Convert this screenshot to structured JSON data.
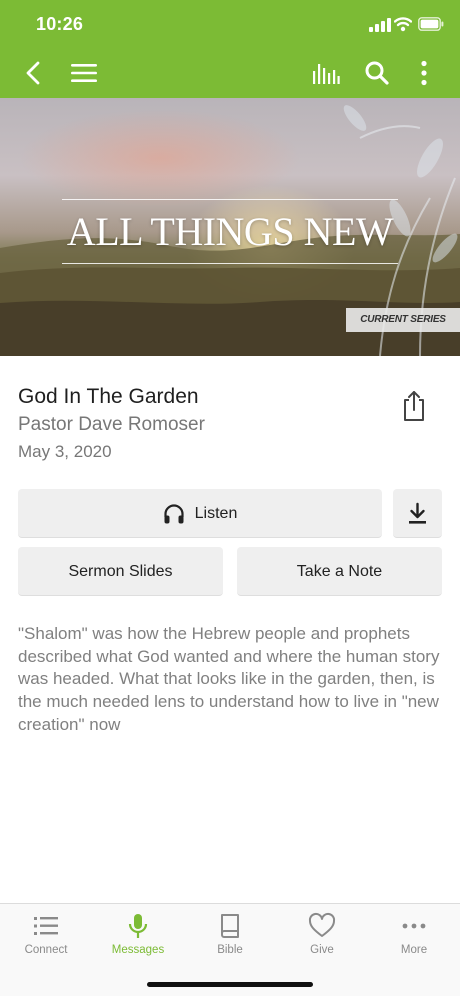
{
  "status_bar": {
    "time": "10:26"
  },
  "nav": {
    "back_icon": "chevron-left-icon",
    "menu_icon": "hamburger-menu-icon",
    "audio_icon": "audio-bars-icon",
    "search_icon": "search-icon",
    "more_icon": "vertical-dots-icon"
  },
  "hero": {
    "title": "ALL THINGS NEW",
    "tag": "CURRENT SERIES"
  },
  "sermon": {
    "title": "God In The Garden",
    "speaker": "Pastor Dave Romoser",
    "date": "May 3, 2020",
    "share_icon": "share-icon"
  },
  "actions": {
    "listen_label": "Listen",
    "listen_icon": "headphones-icon",
    "download_icon": "download-icon",
    "slides_label": "Sermon Slides",
    "note_label": "Take a Note"
  },
  "description": "\"Shalom\" was how the Hebrew people and prophets described what God wanted and where the human story was headed.  What that looks like in the garden, then, is the much needed lens to understand how to live in \"new creation\" now",
  "tabbar": {
    "items": [
      {
        "label": "Connect",
        "icon": "list-icon",
        "active": false
      },
      {
        "label": "Messages",
        "icon": "microphone-icon",
        "active": true
      },
      {
        "label": "Bible",
        "icon": "book-icon",
        "active": false
      },
      {
        "label": "Give",
        "icon": "heart-icon",
        "active": false
      },
      {
        "label": "More",
        "icon": "horizontal-dots-icon",
        "active": false
      }
    ]
  },
  "colors": {
    "brand_green": "#7cbb35",
    "tab_inactive": "#8a8a8a",
    "button_bg": "#efefef"
  }
}
